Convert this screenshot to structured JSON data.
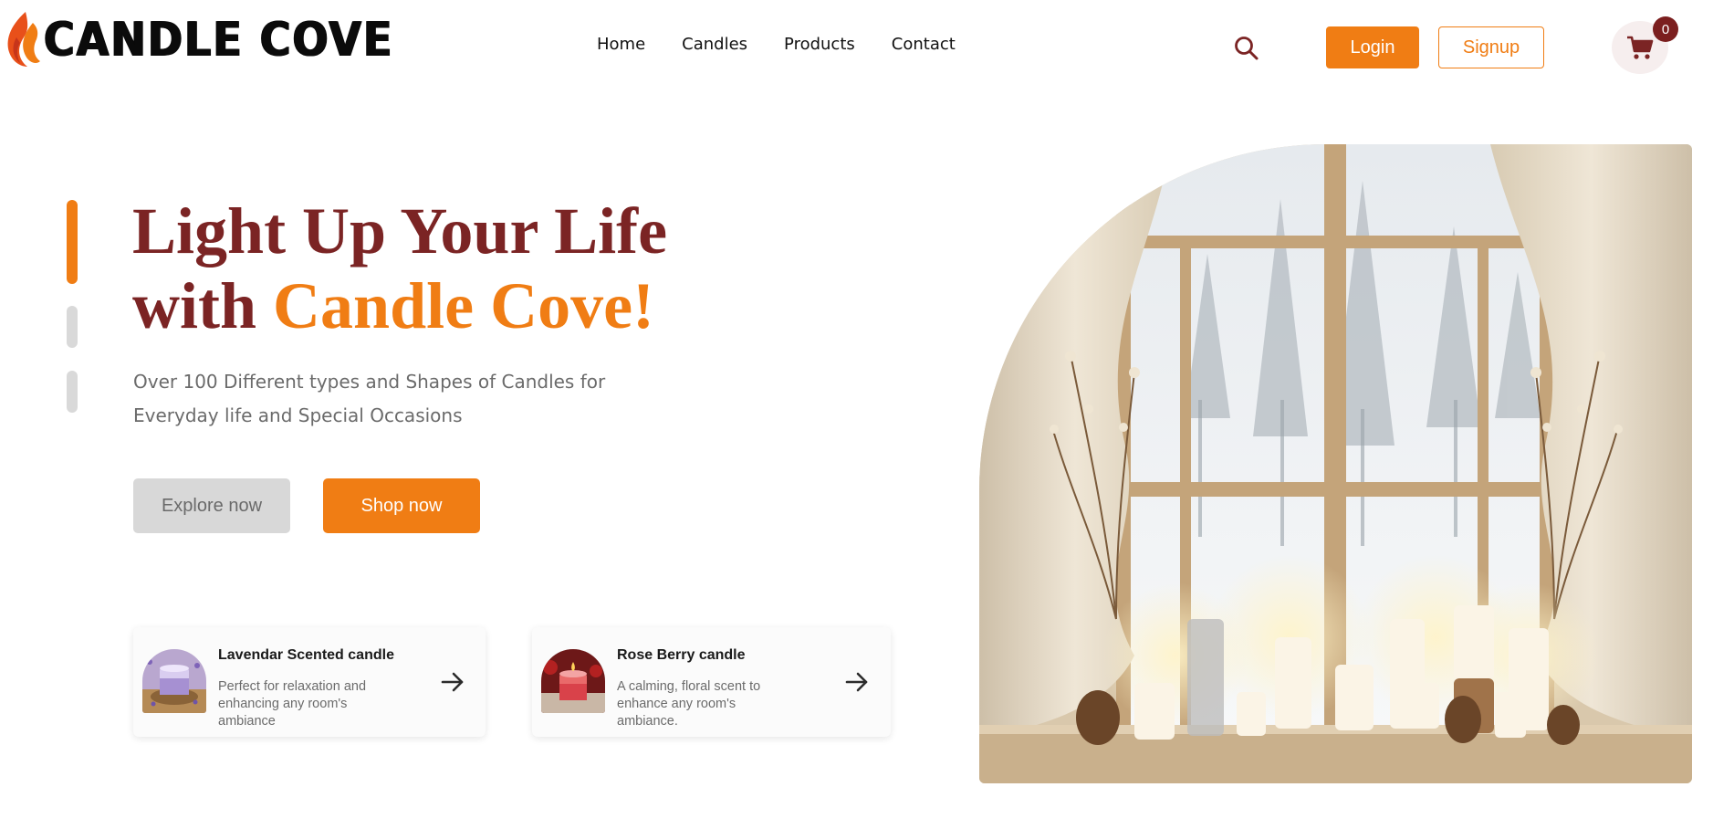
{
  "brand": {
    "name": "CANDLE COVE"
  },
  "nav": {
    "items": [
      {
        "label": "Home"
      },
      {
        "label": "Candles"
      },
      {
        "label": "Products"
      },
      {
        "label": "Contact"
      }
    ]
  },
  "header": {
    "search_icon": "search-icon",
    "login_label": "Login",
    "signup_label": "Signup",
    "cart_icon": "shopping-cart-icon",
    "cart_count": "0"
  },
  "hero": {
    "title_line1": "Light Up Your Life",
    "title_line2_prefix": "with ",
    "title_line2_accent": "Candle Cove!",
    "subtitle": "Over 100 Different types and Shapes of Candles for Everyday life and Special Occasions",
    "explore_label": "Explore now",
    "shop_label": "Shop now"
  },
  "products": [
    {
      "title": "Lavendar Scented candle",
      "description": "Perfect for relaxation and enhancing any room's ambiance",
      "icon": "arrow-right-icon"
    },
    {
      "title": "Rose Berry candle",
      "description": "A calming, floral scent to enhance any room's ambiance.",
      "icon": "arrow-right-icon"
    }
  ],
  "colors": {
    "accent": "#f07d14",
    "brand_dark": "#7b2424",
    "badge": "#7b1e1e",
    "muted_button": "#d8d8d8"
  }
}
